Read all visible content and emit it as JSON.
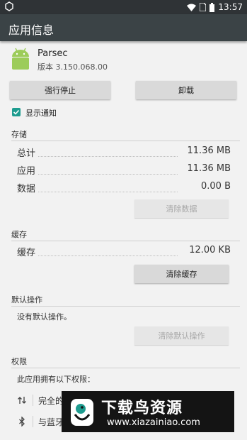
{
  "status_bar": {
    "time": "13:57"
  },
  "app_bar": {
    "title": "应用信息"
  },
  "app": {
    "name": "Parsec",
    "version": "版本 3.150.068.00"
  },
  "buttons": {
    "force_stop": "强行停止",
    "uninstall": "卸载"
  },
  "notifications": {
    "label": "显示通知",
    "checked": true
  },
  "storage": {
    "header": "存储",
    "rows": [
      {
        "label": "总计",
        "value": "11.36 MB"
      },
      {
        "label": "应用",
        "value": "11.36 MB"
      },
      {
        "label": "数据",
        "value": "0.00 B"
      }
    ],
    "clear_data": "清除数据"
  },
  "cache": {
    "header": "缓存",
    "row": {
      "label": "缓存",
      "value": "12.00 KB"
    },
    "clear_cache": "清除缓存"
  },
  "defaults": {
    "header": "默认操作",
    "text": "没有默认操作。",
    "clear_defaults": "清除默认操作"
  },
  "permissions": {
    "header": "权限",
    "intro": "此应用拥有以下权限：",
    "items": [
      {
        "icon": "swap-vert-icon",
        "text": "完全的"
      },
      {
        "icon": "bluetooth-icon",
        "text": "与蓝牙"
      }
    ]
  },
  "watermark": {
    "title": "下载鸟资源",
    "url": "www.xiazainiao.com"
  },
  "colors": {
    "accent": "#1e9c8f",
    "app_bar": "#3b4346",
    "status_bar": "#2f3336",
    "android_green": "#9ccc5a"
  }
}
